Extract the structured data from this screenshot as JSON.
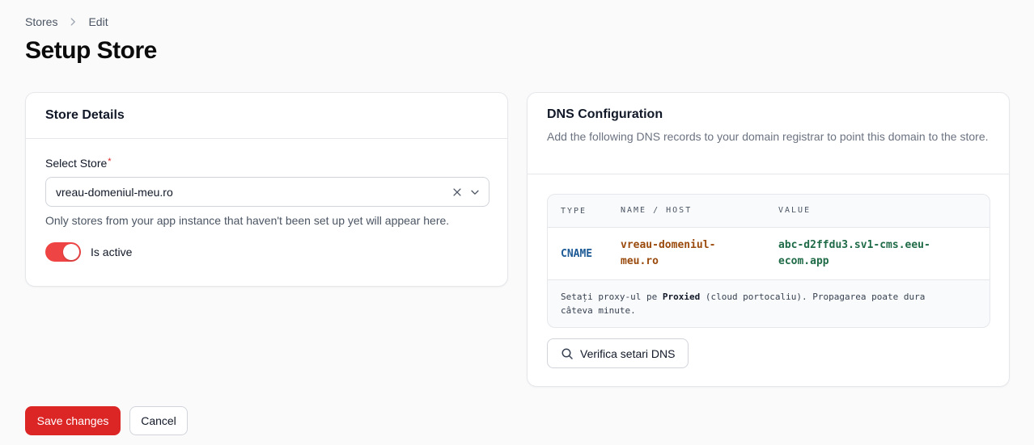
{
  "colors": {
    "accent": "#dc2626",
    "toggle_on": "#ef4444",
    "dns_type": "#1e5a96",
    "dns_name": "#9a4a0c",
    "dns_value": "#1f6b47"
  },
  "breadcrumb": {
    "items": [
      "Stores",
      "Edit"
    ],
    "separator_icon": "chevron-right-icon"
  },
  "page": {
    "title": "Setup Store"
  },
  "store_details": {
    "title": "Store Details",
    "select_label": "Select Store",
    "required_marker": "*",
    "selected_value": "vreau-domeniul-meu.ro",
    "helper": "Only stores from your app instance that haven't been set up yet will appear here.",
    "toggle_label": "Is active",
    "toggle_on": true
  },
  "dns": {
    "title": "DNS Configuration",
    "description": "Add the following DNS records to your domain registrar to point this domain to the store.",
    "columns": [
      "TYPE",
      "NAME / HOST",
      "VALUE"
    ],
    "record": {
      "type": "CNAME",
      "name_line1": "vreau-domeniul-",
      "name_line2": "meu.ro",
      "value_line1": "abc-d2ffdu3.sv1-cms.eeu-",
      "value_line2": "ecom.app"
    },
    "note": {
      "before": "Setați proxy-ul pe ",
      "bold": "Proxied",
      "after": " (cloud portocaliu). Propagarea poate dura",
      "line2": "câteva minute."
    },
    "verify_button": "Verifica setari DNS"
  },
  "actions": {
    "save": "Save changes",
    "cancel": "Cancel"
  }
}
